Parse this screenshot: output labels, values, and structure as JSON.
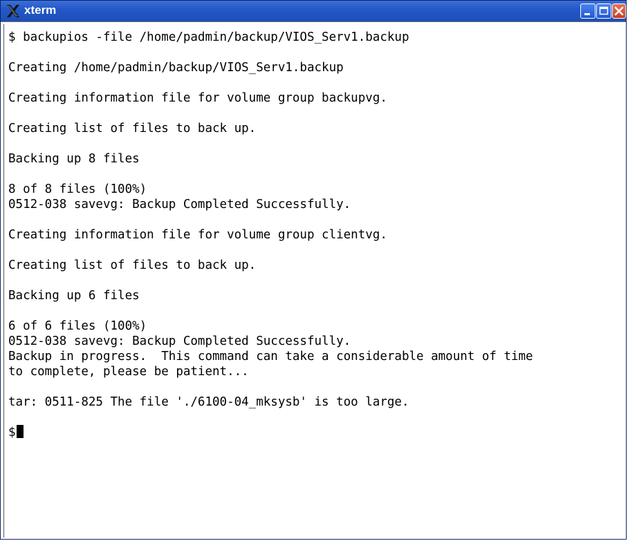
{
  "window": {
    "title": "xterm"
  },
  "terminal": {
    "lines": [
      "$ backupios -file /home/padmin/backup/VIOS_Serv1.backup",
      "",
      "Creating /home/padmin/backup/VIOS_Serv1.backup",
      "",
      "Creating information file for volume group backupvg.",
      "",
      "Creating list of files to back up.",
      "",
      "Backing up 8 files",
      "",
      "8 of 8 files (100%)",
      "0512-038 savevg: Backup Completed Successfully.",
      "",
      "Creating information file for volume group clientvg.",
      "",
      "Creating list of files to back up.",
      "",
      "Backing up 6 files",
      "",
      "6 of 6 files (100%)",
      "0512-038 savevg: Backup Completed Successfully.",
      "Backup in progress.  This command can take a considerable amount of time",
      "to complete, please be patient...",
      "",
      "tar: 0511-825 The file './6100-04_mksysb' is too large.",
      "",
      "$"
    ]
  },
  "colors": {
    "titlebar": "#2458c8",
    "terminal_bg": "#ffffff",
    "terminal_fg": "#000000",
    "close_button": "#c4401f"
  },
  "icons": [
    "x-logo-icon",
    "minimize-icon",
    "maximize-icon",
    "close-icon"
  ]
}
